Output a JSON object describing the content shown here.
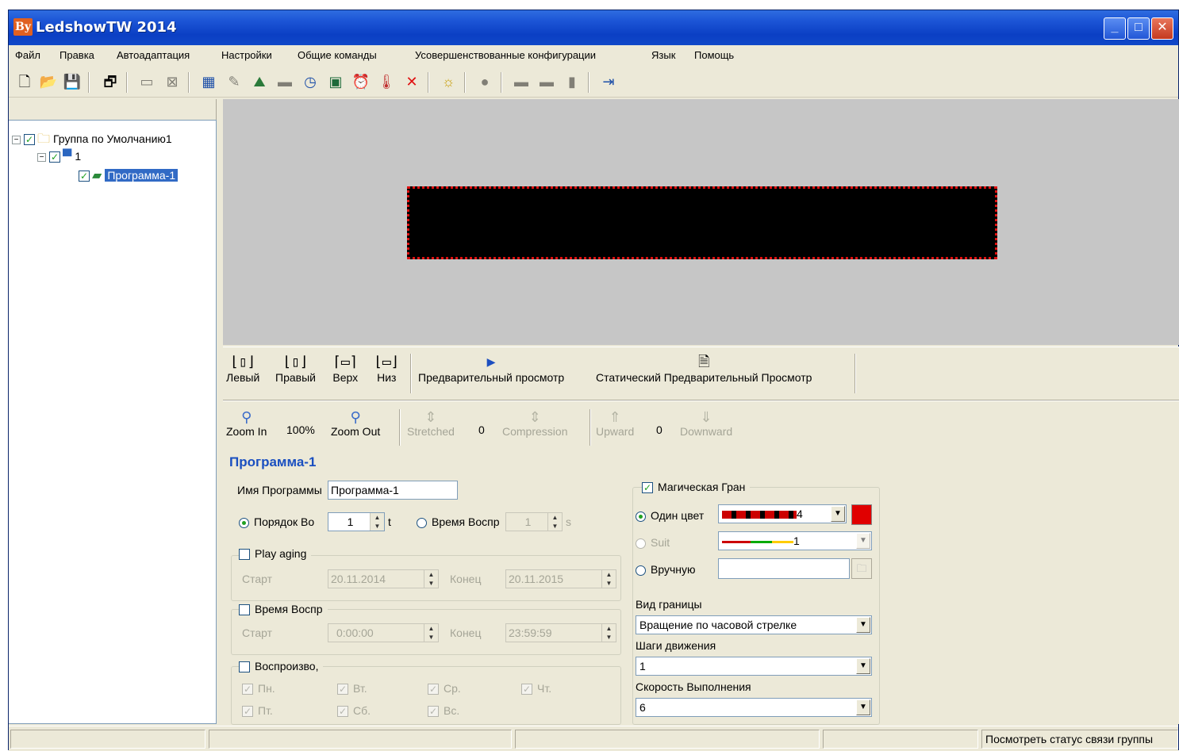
{
  "window": {
    "title": "LedshowTW 2014",
    "logo": "By"
  },
  "menu": [
    "Файл",
    "Правка",
    "Автоадаптация",
    "Настройки",
    "Общие команды",
    "Усовершенствованные конфигурации",
    "Язык",
    "Помощь"
  ],
  "toolbar_icons": [
    "new-file-icon",
    "open-folder-icon",
    "save-icon",
    "screen-icon",
    "area-icon",
    "text-area-icon",
    "table-icon",
    "edit-icon",
    "picture-icon",
    "subtitle-icon",
    "clock-icon",
    "calendar-icon",
    "alarm-icon",
    "temperature-icon",
    "delete-icon",
    "brightness-icon",
    "stop-icon",
    "send-icon",
    "receive-icon",
    "usb-icon",
    "exit-icon"
  ],
  "tree": {
    "group": "Группа по Умолчанию1",
    "screen": "1",
    "program": "Программа-1"
  },
  "align": {
    "left": "Левый",
    "right": "Правый",
    "top": "Верх",
    "bottom": "Низ",
    "preview": "Предварительный просмотр",
    "static_preview": "Статический Предварительный Просмотр"
  },
  "zoom": {
    "zoom_in": "Zoom In",
    "zoom_level": "100%",
    "zoom_out": "Zoom Out",
    "stretched": "Stretched",
    "stretch_value": "0",
    "compression": "Compression",
    "upward": "Upward",
    "shift_value": "0",
    "downward": "Downward"
  },
  "program": {
    "title": "Программа-1",
    "name_label": "Имя Программы",
    "name_value": "Программа-1",
    "order_label": "Порядок Во",
    "order_value": "1",
    "order_unit": "t",
    "time_label": "Время Воспр",
    "time_value": "1",
    "time_unit": "s",
    "play_aging": "Play aging",
    "start_label": "Старт",
    "start_date": "20.11.2014",
    "end_label": "Конец",
    "end_date": "20.11.2015",
    "play_time": "Время Воспр",
    "start_time": "0:00:00",
    "end_time": "23:59:59",
    "playback": "Воспроизво,",
    "days": [
      "Пн.",
      "Вт.",
      "Ср.",
      "Чт.",
      "Пт.",
      "Сб.",
      "Вс."
    ]
  },
  "border": {
    "magic_label": "Магическая Гран",
    "single_color": "Один цвет",
    "single_value": "4",
    "suit": "Suit",
    "suit_value": "1",
    "manual": "Вручную",
    "type_label": "Вид границы",
    "type_value": "Вращение по часовой стрелке",
    "steps_label": "Шаги движения",
    "steps_value": "1",
    "speed_label": "Скорость Выполнения",
    "speed_value": "6",
    "color": "#e00000"
  },
  "status": {
    "text": "Посмотреть статус связи группы"
  },
  "colors": {
    "title_bar": "#0b3fc4",
    "led_border": "#e01010",
    "selection": "#316ac5"
  }
}
